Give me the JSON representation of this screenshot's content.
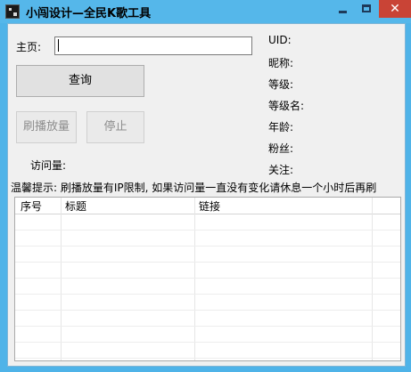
{
  "window": {
    "title": "小闯设计—全民K歌工具",
    "minimize": "—",
    "maximize": "□",
    "close": "✕"
  },
  "form": {
    "home_label": "主页:",
    "home_value": "",
    "query_button": "查询",
    "refresh_button": "刷播放量",
    "stop_button": "停止",
    "visits_label": "访问量:"
  },
  "info": {
    "uid": "UID:",
    "nickname": "昵称:",
    "level": "等级:",
    "level_name": "等级名:",
    "age": "年龄:",
    "fans": "粉丝:",
    "follow": "关注:"
  },
  "notice": "温馨提示: 刷播放量有IP限制, 如果访问量一直没有变化请休息一个小时后再刷",
  "table": {
    "columns": [
      "序号",
      "标题",
      "链接"
    ],
    "rows": []
  }
}
